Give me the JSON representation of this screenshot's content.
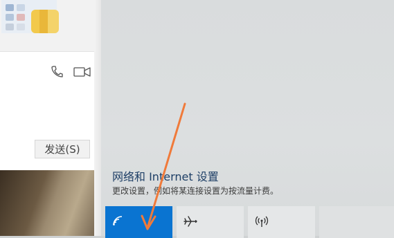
{
  "chat_window": {
    "send_label": "发送(S)",
    "icons": [
      "phone-icon",
      "video-icon"
    ]
  },
  "action_center": {
    "network_title": "网络和 Internet 设置",
    "network_desc": "更改设置，例如将某连接设置为按流量计费。",
    "quick_actions": [
      {
        "name": "wifi",
        "icon": "wifi-icon",
        "state": "on"
      },
      {
        "name": "airplane",
        "icon": "airplane-icon",
        "state": "off"
      },
      {
        "name": "mobile-hotspot",
        "icon": "hotspot-icon",
        "state": "off"
      }
    ],
    "accent_color": "#0a74d1",
    "annotation_color": "#f07a3a"
  }
}
